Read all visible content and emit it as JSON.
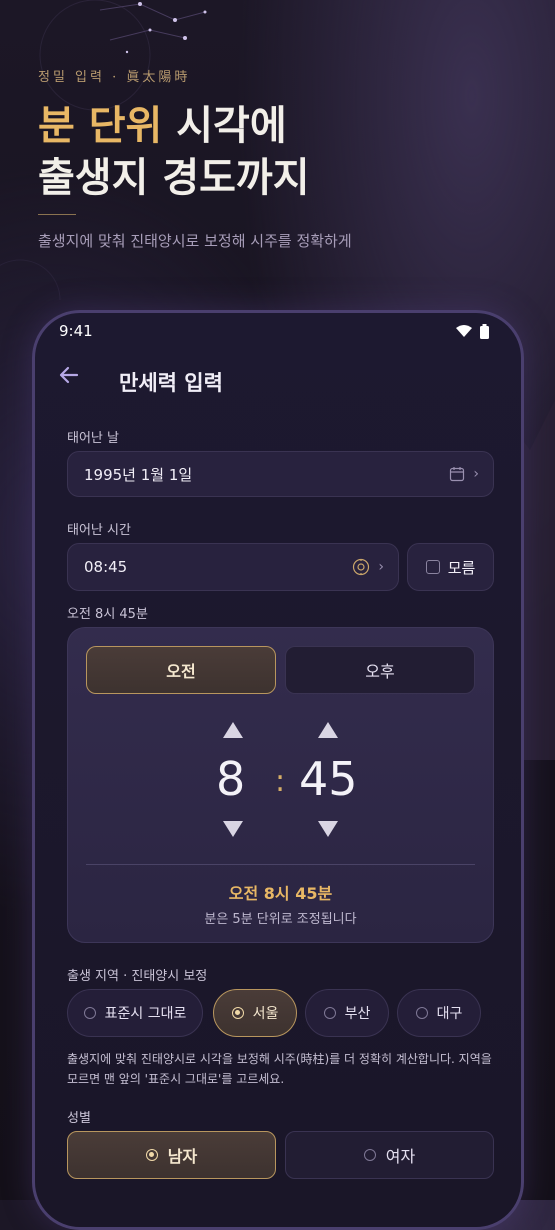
{
  "hero": {
    "eyebrow": "정밀 입력 · 眞太陽時",
    "title_accent": "분 단위",
    "title_rest": " 시각에",
    "title_line2": "출생지 경도까지",
    "subtitle": "출생지에 맞춰 진태양시로 보정해 시주를 정확하게"
  },
  "status_bar": {
    "time": "9:41"
  },
  "appbar": {
    "title": "만세력 입력"
  },
  "birth_date": {
    "label": "태어난 날",
    "value": "1995년 1월 1일"
  },
  "birth_time": {
    "label": "태어난 시간",
    "value": "08:45",
    "unknown_label": "모름",
    "summary": "오전 8시 45분"
  },
  "picker": {
    "am_label": "오전",
    "pm_label": "오후",
    "selected_period": "am",
    "hour": "8",
    "minute": "45",
    "colon": ":",
    "summary": "오전 8시 45분",
    "note": "분은 5분 단위로 조정됩니다"
  },
  "region": {
    "label": "출생 지역 · 진태양시 보정",
    "options": [
      "표준시 그대로",
      "서울",
      "부산",
      "대구"
    ],
    "selected": "서울",
    "note": "출생지에 맞춰 진태양시로 시각을 보정해 시주(時柱)를 더 정확히 계산합니다. 지역을 모르면 맨 앞의 '표준시 그대로'를 고르세요."
  },
  "gender": {
    "label": "성별",
    "options": [
      "남자",
      "여자"
    ],
    "selected": "남자"
  },
  "colors": {
    "accent_gold": "#e8b765",
    "background": "#17131f",
    "card": "#28223e",
    "phone_border": "#4a3f6e"
  }
}
